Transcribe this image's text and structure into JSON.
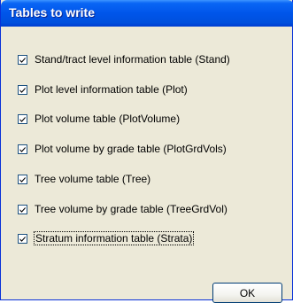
{
  "window": {
    "title": "Tables to write"
  },
  "options": [
    {
      "label": "Stand/tract  level information table (Stand)",
      "checked": true
    },
    {
      "label": "Plot level information table (Plot)",
      "checked": true
    },
    {
      "label": "Plot volume table (PlotVolume)",
      "checked": true
    },
    {
      "label": "Plot volume  by grade table (PlotGrdVols)",
      "checked": true
    },
    {
      "label": "Tree volume table (Tree)",
      "checked": true
    },
    {
      "label": "Tree volume by grade table (TreeGrdVol)",
      "checked": true
    },
    {
      "label": "Stratum information  table (Strata)",
      "checked": true
    }
  ],
  "buttons": {
    "ok_label": "OK"
  },
  "colors": {
    "title_bar": "#0055ea",
    "dialog_face": "#ece9d8",
    "check_mark": "#21a121"
  }
}
